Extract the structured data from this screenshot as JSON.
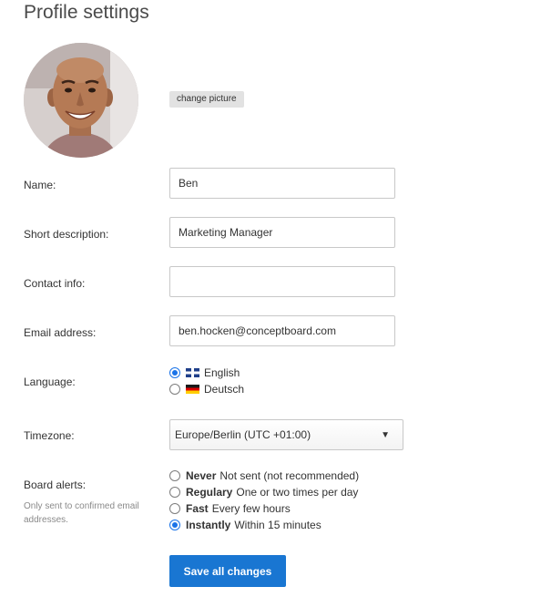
{
  "page": {
    "title": "Profile settings"
  },
  "avatar": {
    "change_picture_label": "change picture"
  },
  "fields": {
    "name": {
      "label": "Name:",
      "value": "Ben"
    },
    "short_description": {
      "label": "Short description:",
      "value": "Marketing Manager"
    },
    "contact_info": {
      "label": "Contact info:",
      "value": ""
    },
    "email": {
      "label": "Email address:",
      "value": "ben.hocken@conceptboard.com"
    }
  },
  "language": {
    "label": "Language:",
    "options": [
      {
        "label": "English",
        "flag": "uk-flag-icon",
        "checked": true
      },
      {
        "label": "Deutsch",
        "flag": "german-flag-icon",
        "checked": false
      }
    ]
  },
  "timezone": {
    "label": "Timezone:",
    "selected": "Europe/Berlin (UTC +01:00)",
    "caret": "▼"
  },
  "board_alerts": {
    "label": "Board alerts:",
    "note": "Only sent to confirmed email addresses.",
    "options": [
      {
        "title": "Never",
        "description": "Not sent (not recommended)",
        "checked": false
      },
      {
        "title": "Regulary",
        "description": "One or two times per day",
        "checked": false
      },
      {
        "title": "Fast",
        "description": "Every few hours",
        "checked": false
      },
      {
        "title": "Instantly",
        "description": "Within 15 minutes",
        "checked": true
      }
    ]
  },
  "actions": {
    "save_label": "Save all changes"
  },
  "colors": {
    "accent": "#1976d2",
    "radio_checked": "#1a73e8",
    "input_border": "#c8c8c8"
  }
}
